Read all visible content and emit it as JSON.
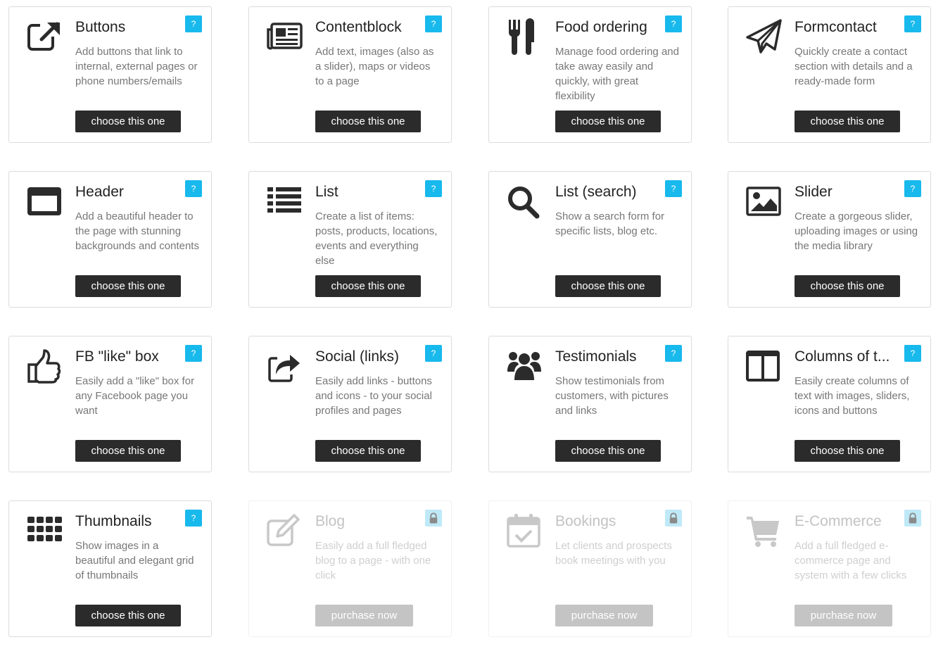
{
  "cards": [
    {
      "id": "buttons",
      "title": "Buttons",
      "desc": "Add buttons that link to internal, external pages or phone numbers/emails",
      "button": "choose this one",
      "help": "?",
      "icon": "external-link-icon",
      "locked": false
    },
    {
      "id": "contentblock",
      "title": "Contentblock",
      "desc": "Add text, images (also as a slider), maps or videos to a page",
      "button": "choose this one",
      "help": "?",
      "icon": "newspaper-icon",
      "locked": false
    },
    {
      "id": "food-ordering",
      "title": "Food ordering",
      "desc": "Manage food ordering and take away easily and quickly, with great flexibility",
      "button": "choose this one",
      "help": "?",
      "icon": "cutlery-icon",
      "locked": false
    },
    {
      "id": "formcontact",
      "title": "Formcontact",
      "desc": "Quickly create a contact section with details and a ready-made form",
      "button": "choose this one",
      "help": "?",
      "icon": "paper-plane-icon",
      "locked": false
    },
    {
      "id": "header",
      "title": "Header",
      "desc": "Add a beautiful header to the page with stunning backgrounds and contents",
      "button": "choose this one",
      "help": "?",
      "icon": "window-icon",
      "locked": false
    },
    {
      "id": "list",
      "title": "List",
      "desc": "Create a list of items: posts, products, locations, events and everything else",
      "button": "choose this one",
      "help": "?",
      "icon": "list-icon",
      "locked": false
    },
    {
      "id": "list-search",
      "title": "List (search)",
      "desc": "Show a search form for specific lists, blog etc.",
      "button": "choose this one",
      "help": "?",
      "icon": "search-icon",
      "locked": false
    },
    {
      "id": "slider",
      "title": "Slider",
      "desc": "Create a gorgeous slider, uploading images or using the media library",
      "button": "choose this one",
      "help": "?",
      "icon": "image-icon",
      "locked": false
    },
    {
      "id": "fb-like",
      "title": "FB \"like\" box",
      "desc": "Easily add a \"like\" box for any Facebook page you want",
      "button": "choose this one",
      "help": "?",
      "icon": "thumbs-up-icon",
      "locked": false
    },
    {
      "id": "social",
      "title": "Social (links)",
      "desc": "Easily add links - buttons and icons - to your social profiles and pages",
      "button": "choose this one",
      "help": "?",
      "icon": "share-icon",
      "locked": false
    },
    {
      "id": "testimonials",
      "title": "Testimonials",
      "desc": "Show testimonials from customers, with pictures and links",
      "button": "choose this one",
      "help": "?",
      "icon": "users-icon",
      "locked": false
    },
    {
      "id": "columns",
      "title": "Columns of t...",
      "desc": "Easily create columns of text with images, sliders, icons and buttons",
      "button": "choose this one",
      "help": "?",
      "icon": "columns-icon",
      "locked": false
    },
    {
      "id": "thumbnails",
      "title": "Thumbnails",
      "desc": "Show images in a beautiful and elegant grid of thumbnails",
      "button": "choose this one",
      "help": "?",
      "icon": "grid-icon",
      "locked": false
    },
    {
      "id": "blog",
      "title": "Blog",
      "desc": "Easily add a full fledged blog to a page - with one click",
      "button": "purchase now",
      "help": "",
      "icon": "edit-icon",
      "locked": true
    },
    {
      "id": "bookings",
      "title": "Bookings",
      "desc": "Let clients and prospects book meetings with you",
      "button": "purchase now",
      "help": "",
      "icon": "calendar-check-icon",
      "locked": true
    },
    {
      "id": "ecommerce",
      "title": "E-Commerce",
      "desc": "Add a full fledged e-commerce page and system with a few clicks",
      "button": "purchase now",
      "help": "",
      "icon": "cart-icon",
      "locked": true
    }
  ]
}
